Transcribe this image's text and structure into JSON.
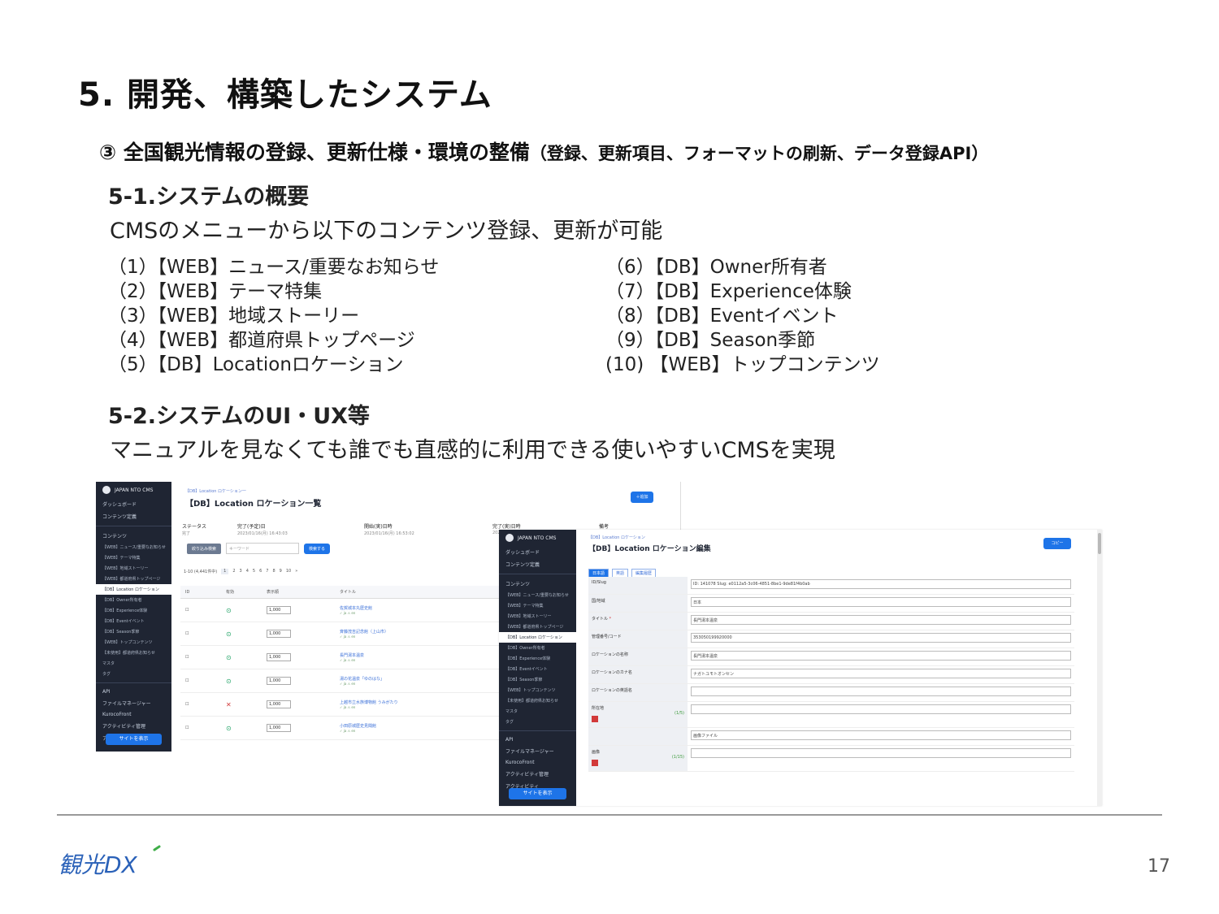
{
  "slide": {
    "title": "5. 開発、構築したシステム",
    "subtitle_main": "③ 全国観光情報の登録、更新仕様・環境の整備",
    "subtitle_paren": "（登録、更新項目、フォーマットの刷新、データ登録API）",
    "section1_head": "5-1.システムの概要",
    "section1_text": "CMSのメニューから以下のコンテンツ登録、更新が可能",
    "section2_head": "5-2.システムのUI・UX等",
    "section2_text": "マニュアルを見なくても誰でも直感的に利用できる使いやすいCMSを実現",
    "page_number": "17",
    "logo_text": "観光DX"
  },
  "list_left": [
    "（1）【WEB】ニュース/重要なお知らせ",
    "（2）【WEB】テーマ特集",
    "（3）【WEB】地域ストーリー",
    "（4）【WEB】都道府県トップページ",
    "（5）【DB】Locationロケーション"
  ],
  "list_right": [
    "（6）【DB】Owner所有者",
    "（7）【DB】Experience体験",
    "（8）【DB】Eventイベント",
    "（9）【DB】Season季節",
    "(10) 【WEB】トップコンテンツ"
  ],
  "sidebar": {
    "brand": "JAPAN NTO CMS",
    "items": [
      "ダッシュボード",
      "コンテンツ定義",
      "コンテンツ"
    ],
    "subitems": [
      "【WEB】ニュース/重要なお知らせ",
      "【WEB】テーマ特集",
      "【WEB】地域ストーリー",
      "【WEB】都道府県トップページ",
      "【DB】Location ロケーション",
      "【DB】Owner所有者",
      "【DB】Experience体験",
      "【DB】Eventイベント",
      "【DB】Season季節",
      "【WEB】トップコンテンツ",
      "【未使用】都道府県お知らせ",
      "マスタ",
      "タグ"
    ],
    "lower": [
      "API",
      "ファイルマネージャー",
      "KurocoFront",
      "アクティビティ管理",
      "アクティビティ"
    ],
    "site_button": "サイトを表示"
  },
  "shot1": {
    "crumb": "【DB】Location ロケーション一",
    "title": "【DB】Location ロケーション一覧",
    "add_button": "＋追加",
    "meta": [
      {
        "label": "ステータス",
        "value": "完了"
      },
      {
        "label": "完了(予定)日",
        "value": "2023/01/16(月) 16:43:03"
      },
      {
        "label": "開始(実)日時",
        "value": "2023/01/16(月) 16:53:02"
      },
      {
        "label": "完了(実)日時",
        "value": "2023/01/16"
      },
      {
        "label": "備考",
        "value": ""
      }
    ],
    "filter_button": "絞り込み検索",
    "search_placeholder": "キーワード",
    "search_button": "検索する",
    "pager_label": "1-10 (4,441件中)",
    "pages": [
      "1",
      "2",
      "3",
      "4",
      "5",
      "6",
      "7",
      "8",
      "9",
      "10",
      "»"
    ],
    "columns": [
      "ID",
      "有効",
      "表示順",
      "タイトル"
    ],
    "rows": [
      {
        "order": "1,000",
        "status": "ok",
        "name": "佐賀城本丸歴史館",
        "sub": "✓ ja  ⚠ en"
      },
      {
        "order": "1,000",
        "status": "ok",
        "name": "斉藤茂吉記念館（上山市）",
        "sub": "✓ ja  ⚠ en"
      },
      {
        "order": "1,000",
        "status": "ok",
        "name": "長門湯本温泉",
        "sub": "✓ ja  ⚠ en"
      },
      {
        "order": "1,000",
        "status": "ok",
        "name": "湯の花温泉「ゆのはな」",
        "sub": "✓ ja  ⚠ en"
      },
      {
        "order": "1,000",
        "status": "ng",
        "name": "上越市立水族博物館 うみがたり",
        "sub": "✓ ja  ⚠ en"
      },
      {
        "order": "1,000",
        "status": "ok",
        "name": "小田原城歴史見聞館",
        "sub": "✓ ja  ⚠ en"
      }
    ]
  },
  "shot2": {
    "crumb": "【DB】Location ロケーション",
    "title": "【DB】Location ロケーション編集",
    "copy_button": "コピー",
    "tabs": [
      "日本語",
      "英語",
      "編集履歴"
    ],
    "fields": [
      {
        "label": "ID/Slug",
        "value": "ID: 141078  Slug: e0112a5-3c06-4851-8be1-9de81f4b0ab"
      },
      {
        "label": "国/地域",
        "value": "日本"
      },
      {
        "label": "タイトル",
        "value": "長門湯本温泉",
        "required": true
      },
      {
        "label": "管理番号/コード",
        "value": "353050199920000"
      },
      {
        "label": "ロケーションの名称",
        "value": "長門湯本温泉"
      },
      {
        "label": "ロケーションのカナ名",
        "value": "ナガトユモトオンセン"
      },
      {
        "label": "ロケーションの英語名",
        "value": ""
      },
      {
        "label": "所在地",
        "value": "",
        "counter": "(1/5)"
      },
      {
        "label": "",
        "value": "画像ファイル"
      },
      {
        "label": "画像",
        "value": "",
        "counter": "(1/15)"
      }
    ]
  },
  "colors": {
    "sidebar": "#1f2533",
    "accent": "#1e74e8",
    "ok": "#21a366",
    "error": "#d23a3a",
    "logo_blue": "#2a61b8",
    "logo_green": "#3fae49"
  }
}
